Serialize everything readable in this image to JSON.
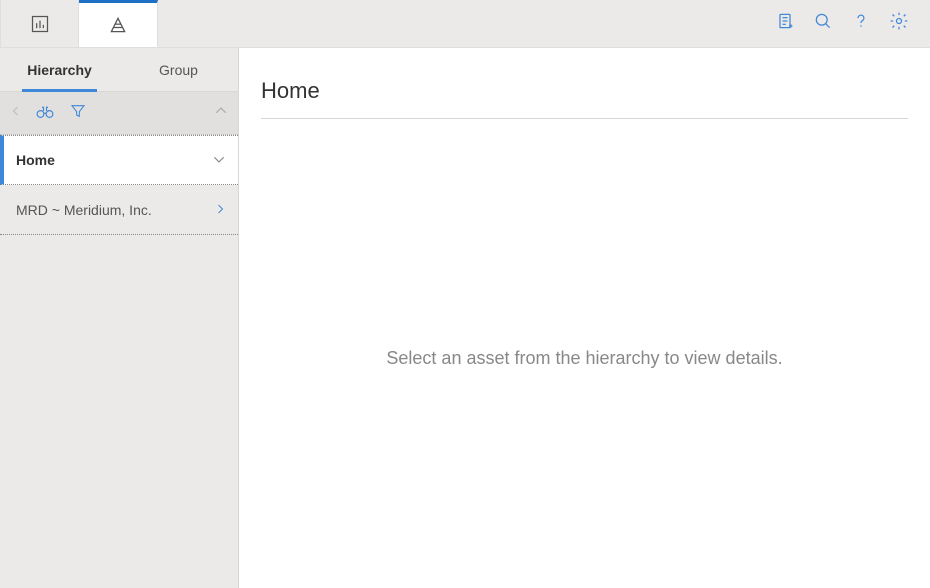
{
  "top_tabs": {
    "dashboard_icon": "dashboard-icon",
    "hierarchy_icon": "hierarchy-icon"
  },
  "top_actions": {
    "clipboard_icon": "clipboard-add-icon",
    "search_icon": "search-icon",
    "help_icon": "help-icon",
    "settings_icon": "settings-gear-icon"
  },
  "sidebar": {
    "tabs": {
      "hierarchy_label": "Hierarchy",
      "group_label": "Group"
    },
    "toolbar": {
      "back_icon": "chevron-left-icon",
      "binoculars_icon": "binoculars-icon",
      "filter_icon": "filter-icon",
      "collapse_icon": "chevron-up-icon"
    },
    "tree": {
      "home_label": "Home",
      "home_expand_icon": "chevron-down-icon",
      "items": [
        {
          "label": "MRD ~ Meridium, Inc.",
          "nav_icon": "chevron-right-icon"
        }
      ]
    }
  },
  "main": {
    "title": "Home",
    "empty_message": "Select an asset from the hierarchy to view details."
  }
}
